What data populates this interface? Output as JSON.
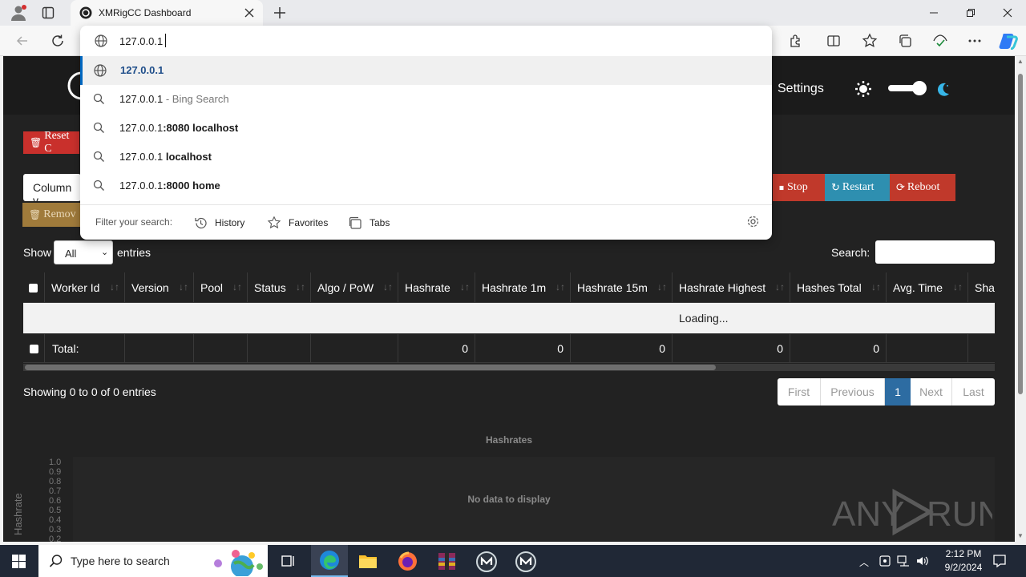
{
  "browser": {
    "tab_title": "XMRigCC Dashboard",
    "address_value": "127.0.0.1",
    "suggestions": [
      {
        "pre": "127.0.0.1",
        "post": "",
        "suffix": "",
        "icon": "globe-icon",
        "selected": true
      },
      {
        "pre": "127.0.0.1",
        "post": "",
        "suffix": " - Bing Search",
        "icon": "search-icon",
        "selected": false
      },
      {
        "pre": "127.0.0.1",
        "post": ":8080 localhost",
        "suffix": "",
        "icon": "search-icon",
        "selected": false
      },
      {
        "pre": "127.0.0.1",
        "post": " localhost",
        "suffix": "",
        "icon": "search-icon",
        "selected": false
      },
      {
        "pre": "127.0.0.1",
        "post": ":8000 home",
        "suffix": "",
        "icon": "search-icon",
        "selected": false
      }
    ],
    "filter_label": "Filter your search:",
    "filters": [
      "History",
      "Favorites",
      "Tabs"
    ]
  },
  "page": {
    "nav_settings": "Settings",
    "buttons": {
      "reset": "Reset C",
      "column": "Column v",
      "remove": "Remov",
      "stop": "Stop",
      "restart": "Restart",
      "reboot": "Reboot"
    },
    "show_label": "Show",
    "show_value": "All",
    "entries_label": "entries",
    "search_label": "Search:",
    "columns": [
      "Worker Id",
      "Version",
      "Pool",
      "Status",
      "Algo / PoW",
      "Hashrate",
      "Hashrate 1m",
      "Hashrate 15m",
      "Hashrate Highest",
      "Hashes Total",
      "Avg. Time",
      "Sha"
    ],
    "loading": "Loading...",
    "total_label": "Total:",
    "total_values": [
      "0",
      "0",
      "0",
      "0",
      "0"
    ],
    "showing": "Showing 0 to 0 of 0 entries",
    "pagination": [
      "First",
      "Previous",
      "1",
      "Next",
      "Last"
    ],
    "chart_title": "Hashrates",
    "chart_empty": "No data to display",
    "chart_ylabel": "Hashrate",
    "chart_yticks": [
      "1.0",
      "0.9",
      "0.8",
      "0.7",
      "0.6",
      "0.5",
      "0.4",
      "0.3",
      "0.2"
    ]
  },
  "watermark": "ANY RUN",
  "taskbar": {
    "search_placeholder": "Type here to search",
    "time": "2:12 PM",
    "date": "9/2/2024"
  },
  "colors": {
    "accent_blue": "#0067c0",
    "page_bg": "#222222",
    "navbar_bg": "#1b1b1b",
    "red": "#c9302c",
    "teal": "#2e8fb0",
    "orange": "#a07b3b"
  }
}
